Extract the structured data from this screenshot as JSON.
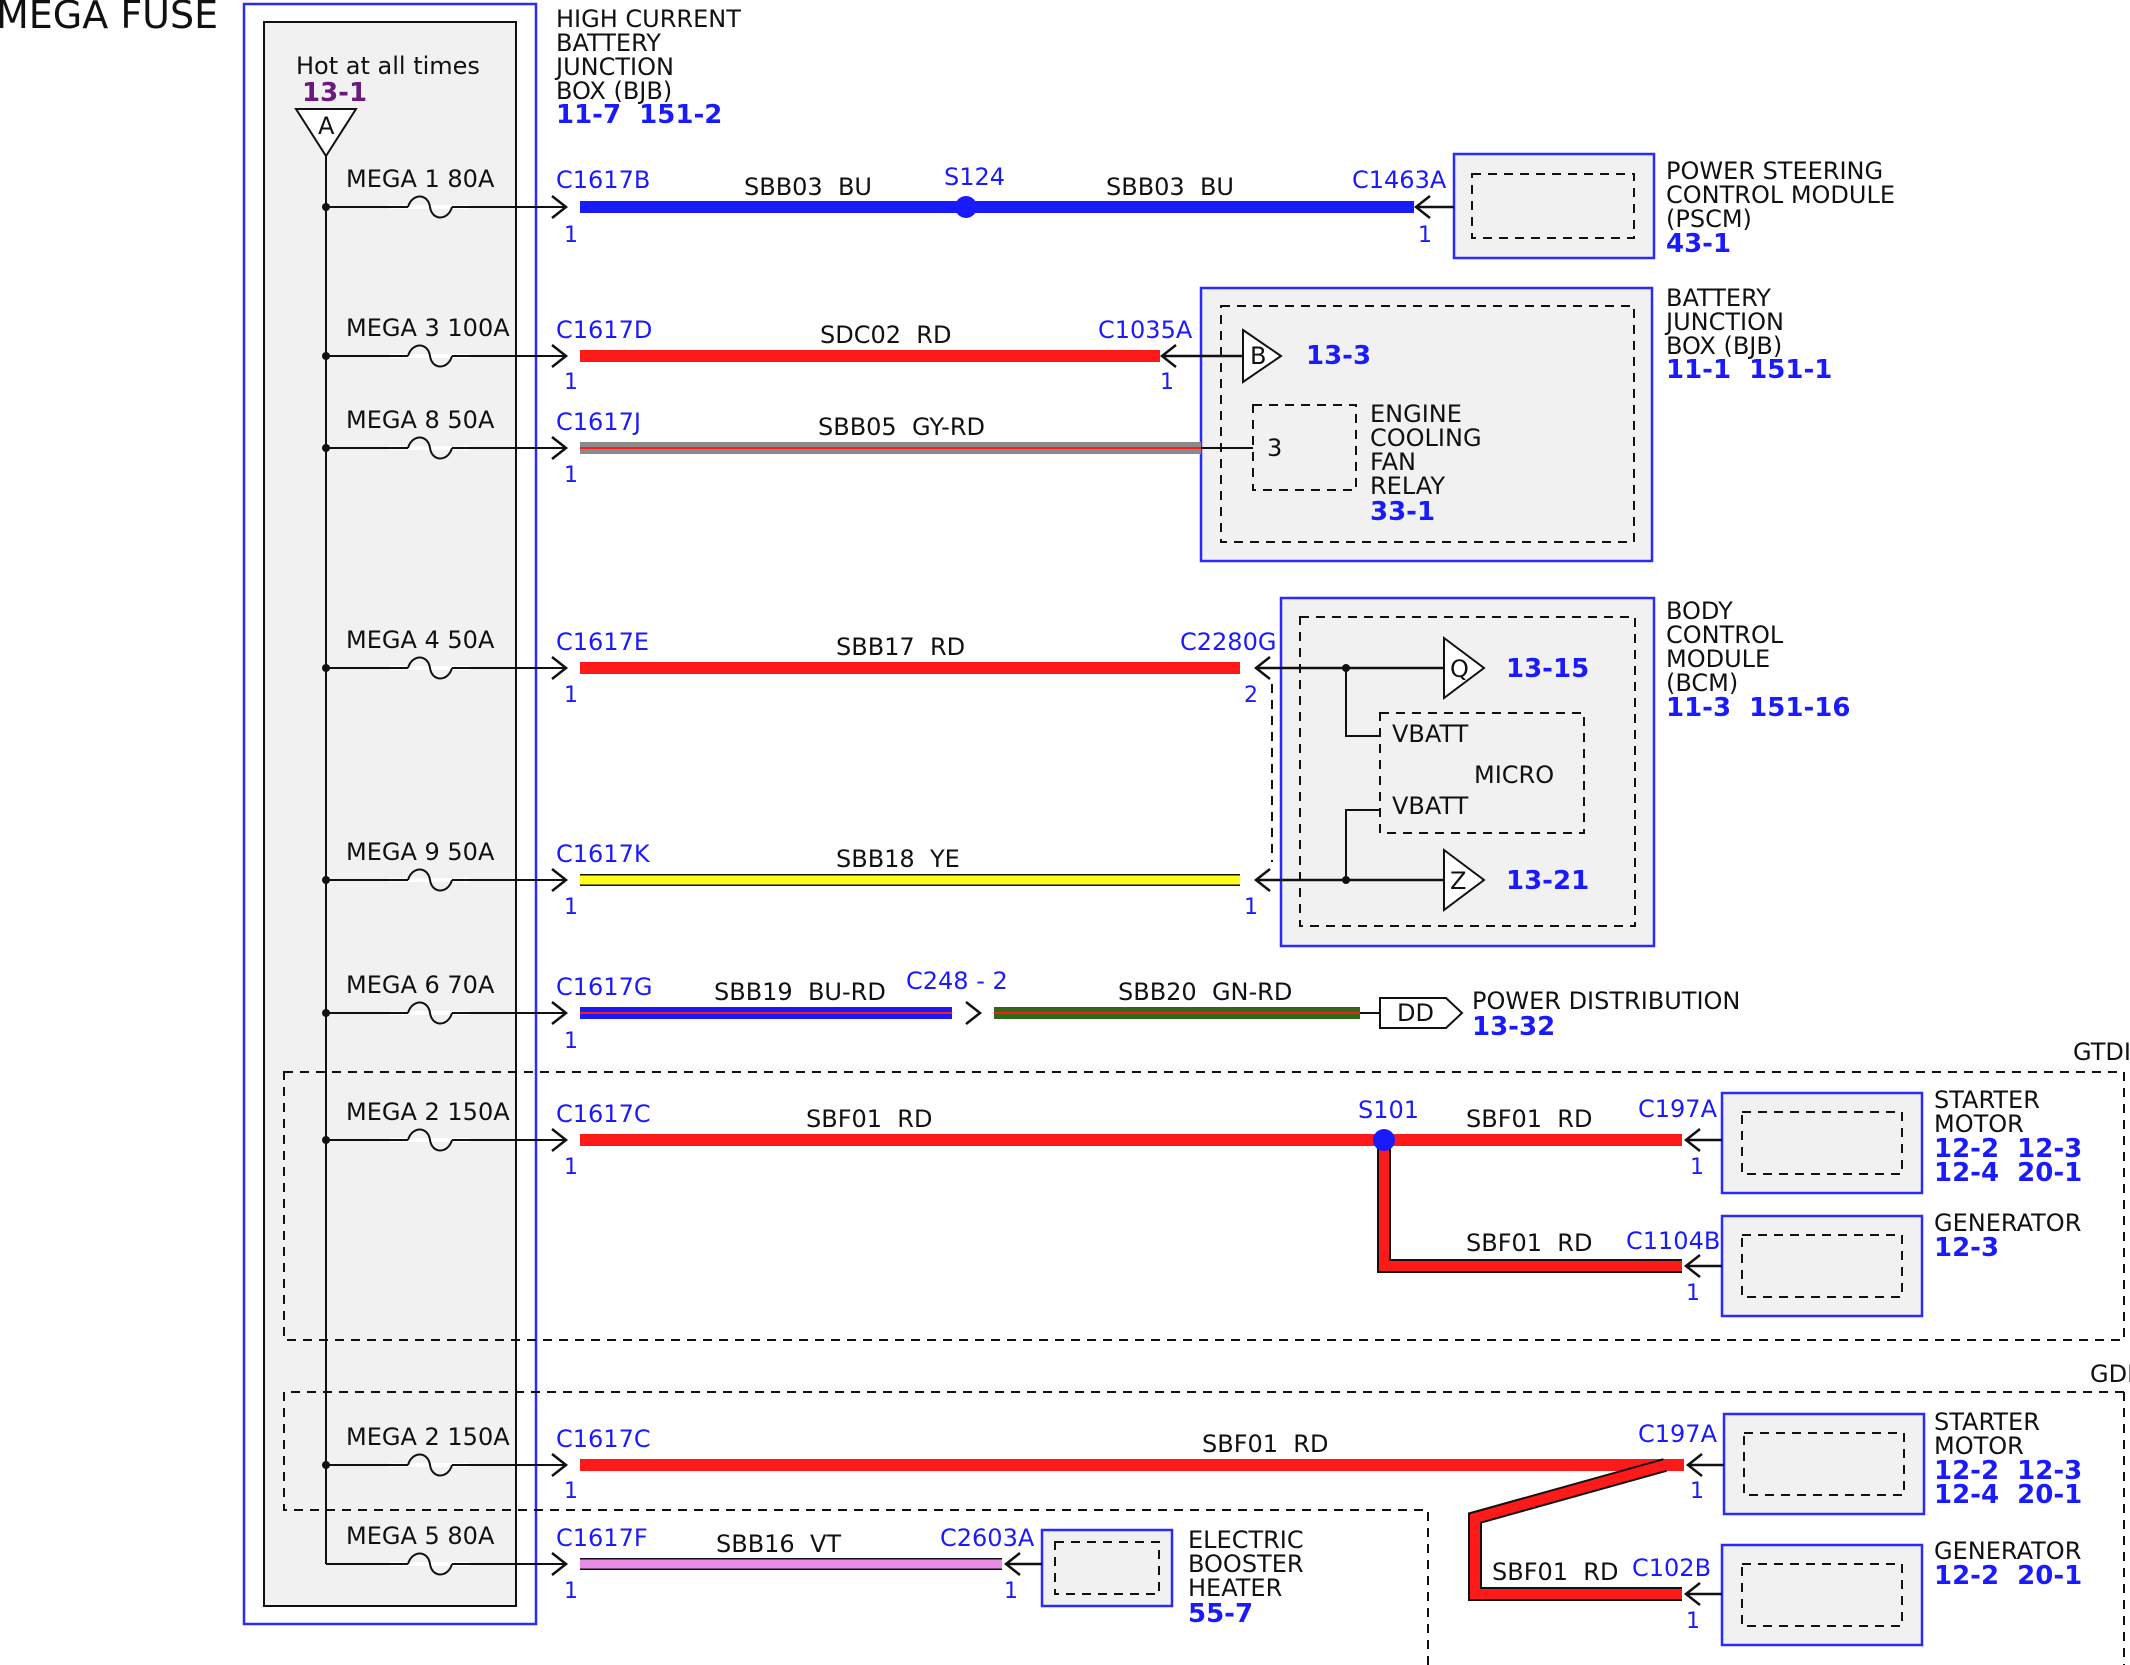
{
  "title": "MEGA FUSE",
  "fuse_box": {
    "hot_label": "Hot at all times",
    "hot_ref": "13-1",
    "hot_connector": "A",
    "name_lines": [
      "HIGH CURRENT",
      "BATTERY",
      "JUNCTION",
      "BOX (BJB)"
    ],
    "refs": "11-7  151-2"
  },
  "fuses": [
    {
      "label": "MEGA 1  80A"
    },
    {
      "label": "MEGA 3  100A"
    },
    {
      "label": "MEGA 8  50A"
    },
    {
      "label": "MEGA 4  50A"
    },
    {
      "label": "MEGA 9  50A"
    },
    {
      "label": "MEGA 6  70A"
    },
    {
      "label": "MEGA 2  150A"
    },
    {
      "label": "MEGA 2  150A"
    },
    {
      "label": "MEGA 5  80A"
    }
  ],
  "connectors": {
    "c1617b": "C1617B",
    "c1617d": "C1617D",
    "c1617j": "C1617J",
    "c1617e": "C1617E",
    "c1617k": "C1617K",
    "c1617g": "C1617G",
    "c1617c": "C1617C",
    "c1617c_gdi": "C1617C",
    "c1617f": "C1617F",
    "c1463a": "C1463A",
    "c1035a": "C1035A",
    "c2280g": "C2280G",
    "c248": "C248 - 2",
    "c197a_gtdi": "C197A",
    "c1104b": "C1104B",
    "c197a_gdi": "C197A",
    "c102b": "C102B",
    "c2603a": "C2603A"
  },
  "pins": {
    "one": "1",
    "two": "2"
  },
  "splices": {
    "s124": "S124",
    "s101": "S101"
  },
  "wires": {
    "sbb03_a": "SBB03  BU",
    "sbb03_b": "SBB03  BU",
    "sdc02": "SDC02  RD",
    "sbb05": "SBB05  GY-RD",
    "sbb17": "SBB17  RD",
    "sbb18": "SBB18  YE",
    "sbb19": "SBB19  BU-RD",
    "sbb20": "SBB20  GN-RD",
    "sbf01_gtdi_main": "SBF01  RD",
    "sbf01_gtdi_starter": "SBF01  RD",
    "sbf01_gtdi_gen": "SBF01  RD",
    "sbf01_gdi_main": "SBF01  RD",
    "sbf01_gdi_gen": "SBF01  RD",
    "sbb16": "SBB16  VT"
  },
  "components": {
    "pscm": {
      "lines": [
        "POWER STEERING",
        "CONTROL MODULE",
        "(PSCM)"
      ],
      "refs": "43-1"
    },
    "bjb": {
      "lines": [
        "BATTERY",
        "JUNCTION",
        "BOX (BJB)"
      ],
      "refs": "11-1  151-1",
      "conn": "B",
      "conn_ref": "13-3"
    },
    "ecfr": {
      "lines": [
        "ENGINE",
        "COOLING",
        "FAN",
        "RELAY"
      ],
      "refs": "33-1",
      "pin": "3"
    },
    "bcm": {
      "lines": [
        "BODY",
        "CONTROL",
        "MODULE",
        "(BCM)"
      ],
      "refs": "11-3  151-16",
      "out_q": "Q",
      "out_q_ref": "13-15",
      "out_z": "Z",
      "out_z_ref": "13-21",
      "micro": "MICRO",
      "vbatt1": "VBATT",
      "vbatt2": "VBATT"
    },
    "power_dist": {
      "label": "POWER DISTRIBUTION",
      "refs": "13-32",
      "conn": "DD"
    },
    "starter_gtdi": {
      "lines": [
        "STARTER",
        "MOTOR"
      ],
      "refs1": "12-2  12-3",
      "refs2": "12-4  20-1"
    },
    "generator_gtdi": {
      "lines": [
        "GENERATOR"
      ],
      "refs": "12-3"
    },
    "starter_gdi": {
      "lines": [
        "STARTER",
        "MOTOR"
      ],
      "refs1": "12-2  12-3",
      "refs2": "12-4  20-1"
    },
    "generator_gdi": {
      "lines": [
        "GENERATOR"
      ],
      "refs": "12-2  20-1"
    },
    "booster": {
      "lines": [
        "ELECTRIC",
        "BOOSTER",
        "HEATER"
      ],
      "refs": "55-7"
    }
  },
  "regions": {
    "gtdi": "GTDI",
    "gdi": "GDI"
  },
  "colors": {
    "blue": "#1a1aff",
    "red": "#ff1a1a",
    "yellow": "#ffff1a",
    "violet": "#e88ce8",
    "gray": "#8a8a8a",
    "green": "#2f6a1a",
    "border_blue": "#2a2aff",
    "module_fill": "#f1f1f1"
  }
}
